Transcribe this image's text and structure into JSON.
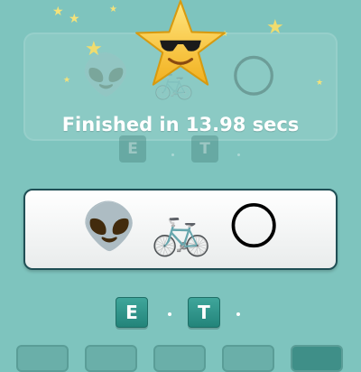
{
  "overlay": {
    "hero_icon": "star-with-sunglasses-icon",
    "finish_message": "Finished in 13.98 secs"
  },
  "background_board": {
    "clue_icons": [
      "alien-icon",
      "bicycle-icon",
      "moon-icon"
    ],
    "answer_letters": [
      "E",
      "T"
    ]
  },
  "puzzle": {
    "clue_icons": [
      "alien-icon",
      "bicycle-icon",
      "full-moon-icon"
    ],
    "clue_glyphs": [
      "👽",
      "🚲",
      "🌕"
    ],
    "answer": [
      {
        "type": "tile",
        "letter": "E"
      },
      {
        "type": "blank"
      },
      {
        "type": "tile",
        "letter": "T"
      },
      {
        "type": "blank"
      }
    ]
  },
  "colors": {
    "background": "#7ec4be",
    "tile": "#2e968b",
    "card_border": "#1f4f55",
    "star": "#f7c934"
  }
}
